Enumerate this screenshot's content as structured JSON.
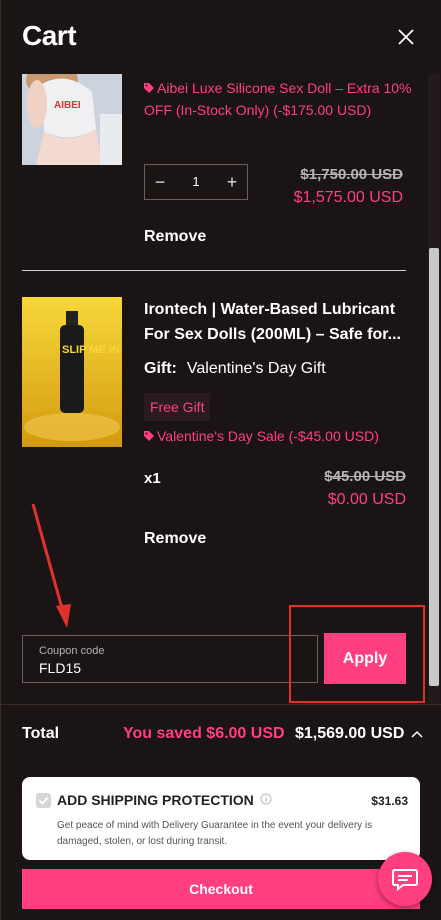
{
  "header": {
    "title": "Cart",
    "close_icon": "close-icon"
  },
  "items": [
    {
      "promo": "Aibei Luxe Silicone Sex Doll – Extra 10% OFF (In-Stock Only) (-$175.00 USD)",
      "quantity": "1",
      "price_old": "$1,750.00 USD",
      "price_new": "$1,575.00 USD",
      "remove_label": "Remove"
    },
    {
      "title": "Irontech | Water-Based Lubricant For Sex Dolls (200ML) – Safe for...",
      "gift_label": "Gift:",
      "gift_value": "Valentine's Day Gift",
      "free_badge": "Free Gift",
      "promo": "Valentine's Day Sale (-$45.00 USD)",
      "quantity_text": "x1",
      "price_old": "$45.00 USD",
      "price_new": "$0.00 USD",
      "remove_label": "Remove",
      "image_text": "SLIP ME IN"
    }
  ],
  "coupon": {
    "label": "Coupon code",
    "value": "FLD15",
    "apply_label": "Apply"
  },
  "footer": {
    "total_label": "Total",
    "saved_text": "You saved $6.00 USD",
    "total_value": "$1,569.00 USD",
    "shipping": {
      "heading": "ADD SHIPPING PROTECTION",
      "price": "$31.63",
      "description": "Get peace of mind with Delivery Guarantee in the event your delivery is damaged, stolen, or lost during transit."
    },
    "checkout_label": "Checkout"
  },
  "colors": {
    "accent": "#ff3f7f",
    "background": "#1b1415",
    "highlight": "#e0322a"
  }
}
